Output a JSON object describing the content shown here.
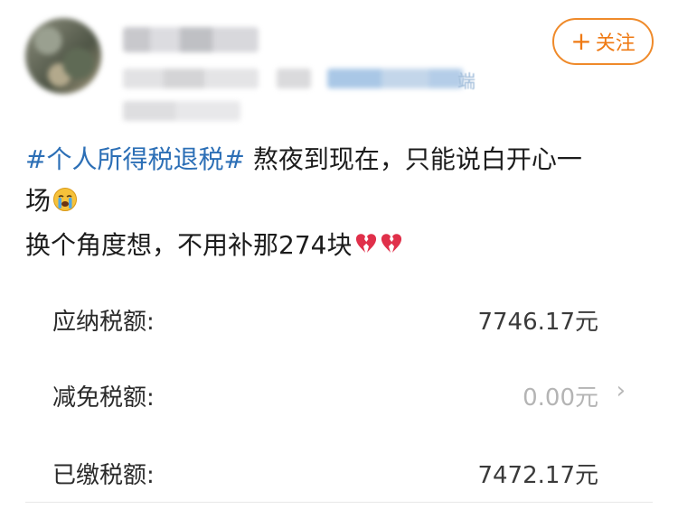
{
  "post_header": {
    "follow_label": "关注",
    "follow_icon": "plus-icon",
    "meta_tail": "端"
  },
  "post": {
    "hashtag": "#个人所得税退税#",
    "line1_rest": " 熬夜到现在，只能说白开心一",
    "line2": "场",
    "line2_emoji": "crying-face-emoji",
    "line3": "换个角度想，不用补那274块",
    "line3_emoji": "broken-heart-emoji",
    "hashtag_color": "#2c6fb6"
  },
  "tax_summary": {
    "rows": [
      {
        "label": "应纳税额:",
        "value": "7746.17元"
      },
      {
        "label": "减免税额:",
        "value": "0.00元"
      },
      {
        "label": "已缴税额:",
        "value": "7472.17元"
      }
    ]
  },
  "colors": {
    "accent": "#ef7a14",
    "link": "#2c6fb6"
  }
}
